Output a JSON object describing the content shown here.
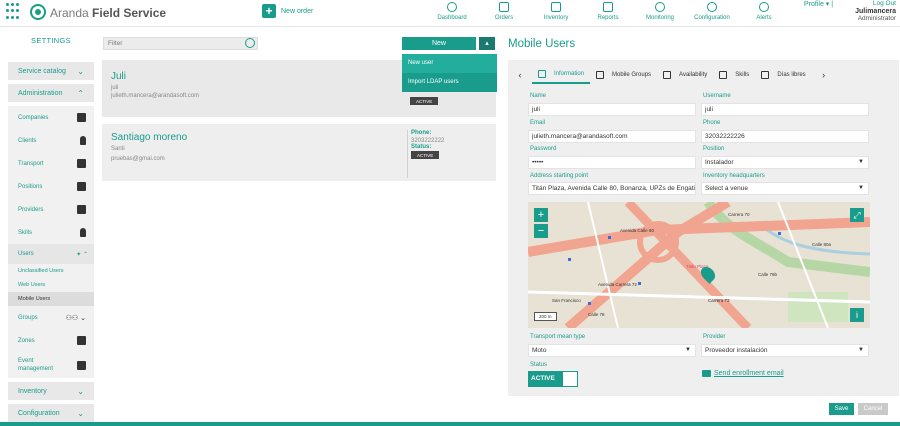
{
  "app": {
    "title_light": "Aranda",
    "title_bold": "Field Service"
  },
  "header": {
    "new_order": "New order",
    "nav": [
      {
        "label": "Dashboard",
        "icon": "dashboard-icon"
      },
      {
        "label": "Orders",
        "icon": "orders-icon"
      },
      {
        "label": "Inventory",
        "icon": "inventory-icon"
      },
      {
        "label": "Reports",
        "icon": "reports-icon"
      },
      {
        "label": "Monitoring",
        "icon": "monitoring-icon"
      },
      {
        "label": "Configuration",
        "icon": "gear-icon"
      },
      {
        "label": "Alerts",
        "icon": "bell-icon"
      }
    ],
    "profile": "Profile",
    "logout": "Log Out",
    "username": "Julimancera",
    "role": "Administrator"
  },
  "sidebar": {
    "title": "SETTINGS",
    "service_catalog": "Service catalog",
    "administration": "Administration",
    "admin_items": [
      "Companies",
      "Clients",
      "Transport",
      "Positions",
      "Providers",
      "Skills"
    ],
    "users": "Users",
    "user_sub": [
      "Unclassified Users",
      "Web Users",
      "Mobile Users"
    ],
    "groups": "Groups",
    "zones": "Zones",
    "event_management_1": "Event",
    "event_management_2": "management",
    "inventory": "Inventory",
    "configuration": "Configuration"
  },
  "list": {
    "filter_placeholder": "Filter",
    "new_button": "New",
    "dropdown": [
      "New user",
      "Import LDAP users"
    ],
    "users": [
      {
        "name": "Juli",
        "short": "juli",
        "email": "julieth.mancera@arandasoft.com",
        "status": "ACTIVE"
      },
      {
        "name": "Santiago moreno",
        "short": "Santi",
        "email": "pruebas@gmai.com",
        "phone_label": "Phone:",
        "phone": "3203222222",
        "status_label": "Status:",
        "status": "ACTIVE"
      }
    ]
  },
  "panel": {
    "title": "Mobile Users",
    "tabs": [
      "Information",
      "Mobile Groups",
      "Availability",
      "Skills",
      "Días libres"
    ],
    "fields": {
      "name_label": "Name",
      "name": "juli",
      "username_label": "Username",
      "username": "juli",
      "email_label": "Email",
      "email": "julieth.mancera@arandasoft.com",
      "phone_label": "Phone",
      "phone": "32032222226",
      "password_label": "Password",
      "password": "•••••",
      "position_label": "Position",
      "position": "Instalador",
      "address_label": "Address starting point",
      "address": "Titán Plaza, Avenida Calle 80, Bonanza, UPZs de Engativá",
      "hq_label": "Inventory headquarters",
      "hq": "Select a venue",
      "transport_label": "Transport mean type",
      "transport": "Moto",
      "provider_label": "Provider",
      "provider": "Proveedor instalación",
      "status_label": "Status",
      "status": "ACTIVE"
    },
    "map": {
      "labels": [
        "Titán Plaza",
        "Avenida Carrera 72",
        "Avenida Calle 80",
        "Calle 79b",
        "Carrera 73",
        "Calle 80a",
        "Calle 78",
        "Carrera 70",
        "San Francisco"
      ],
      "scale": "200 m"
    },
    "enroll_link": "Send enrollment email",
    "save": "Save",
    "cancel": "Cancel"
  },
  "colors": {
    "accent": "#1a9c8c",
    "dark_accent": "#1a7a70"
  }
}
